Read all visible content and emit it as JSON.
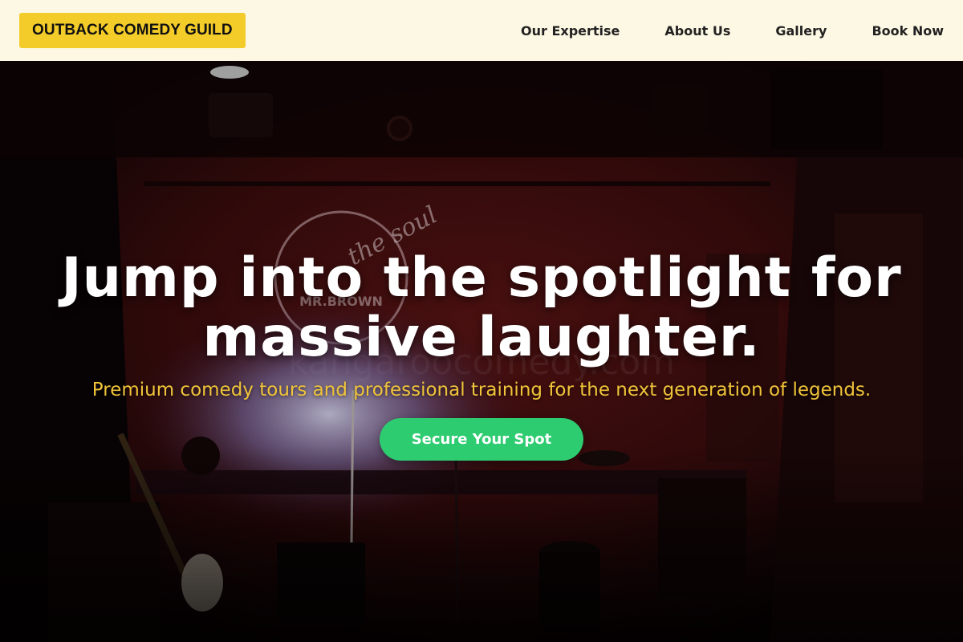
{
  "header": {
    "logo_text": "OUTBACK COMEDY GUILD",
    "nav": [
      {
        "label": "Our Expertise"
      },
      {
        "label": "About Us"
      },
      {
        "label": "Gallery"
      },
      {
        "label": "Book Now"
      }
    ]
  },
  "hero": {
    "title_line1": "Jump into the spotlight for",
    "title_line2": "massive laughter.",
    "subtitle": "Premium comedy tours and professional training for the next generation of legends.",
    "cta_label": "Secure Your Spot",
    "photo": {
      "neon_sign_line1": "the soul",
      "neon_sign_line2": "MR.BROWN",
      "watermark": "kangaroocomedy.com"
    }
  },
  "colors": {
    "header_bg": "#fdf8e4",
    "logo_bg": "#f4cc29",
    "accent_green": "#2ecc71",
    "subtitle_gold": "#f0c43a"
  }
}
